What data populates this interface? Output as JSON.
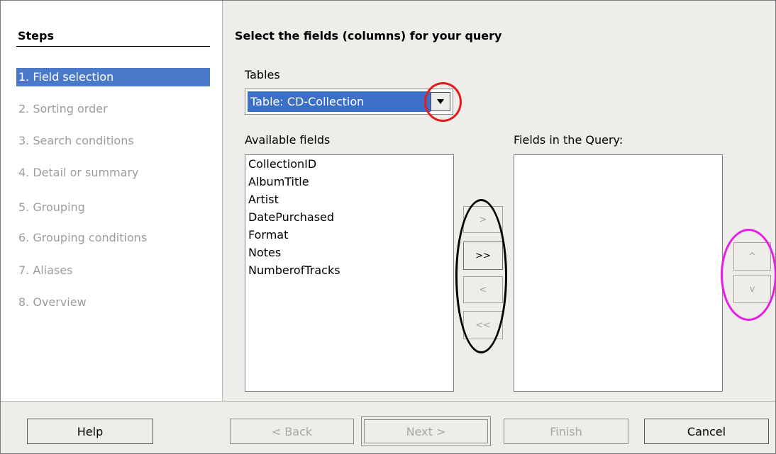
{
  "sidebar": {
    "title": "Steps",
    "items": [
      {
        "label": "1. Field selection",
        "active": true
      },
      {
        "label": "2. Sorting order",
        "active": false
      },
      {
        "label": "3. Search conditions",
        "active": false
      },
      {
        "label": "4. Detail or summary",
        "active": false
      },
      {
        "label": "5. Grouping",
        "active": false
      },
      {
        "label": "6. Grouping conditions",
        "active": false
      },
      {
        "label": "7. Aliases",
        "active": false
      },
      {
        "label": "8. Overview",
        "active": false
      }
    ]
  },
  "main": {
    "title": "Select the fields (columns) for your query",
    "tables_label": "Tables",
    "tables_value": "Table: CD-Collection",
    "available_label": "Available fields",
    "available_fields": [
      "CollectionID",
      "AlbumTitle",
      "Artist",
      "DatePurchased",
      "Format",
      "Notes",
      "NumberofTracks"
    ],
    "query_label": "Fields in the Query:",
    "query_fields": [],
    "move_buttons": {
      "add": ">",
      "add_all": ">>",
      "remove": "<",
      "remove_all": "<<"
    },
    "order_buttons": {
      "up": "^",
      "down": "v"
    }
  },
  "footer": {
    "help": "Help",
    "back": "< Back",
    "next": "Next >",
    "finish": "Finish",
    "cancel": "Cancel"
  },
  "colors": {
    "selection": "#4a79c9",
    "annotation_red": "#e31c1c",
    "annotation_black": "#000000",
    "annotation_magenta": "#e81ce8"
  }
}
